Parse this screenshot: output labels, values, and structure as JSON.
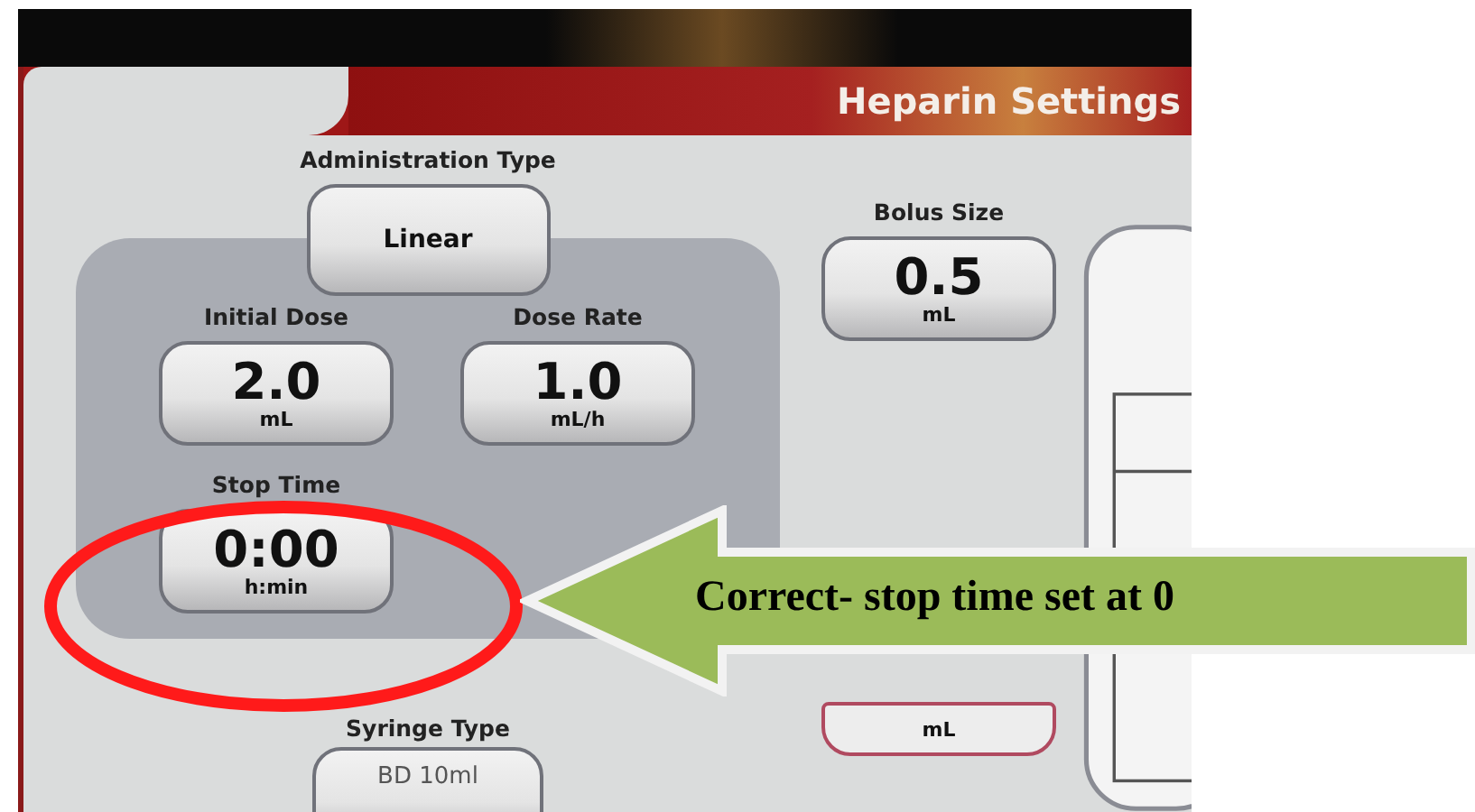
{
  "header": {
    "title": "Heparin Settings"
  },
  "administration_type": {
    "label": "Administration Type",
    "value": "Linear"
  },
  "dose_group": [
    {
      "label": "Initial Dose",
      "value": "2.0",
      "unit": "mL"
    },
    {
      "label": "Dose Rate",
      "value": "1.0",
      "unit": "mL/h"
    },
    {
      "label": "Stop Time",
      "value": "0:00",
      "unit": "h:min"
    }
  ],
  "syringe_type": {
    "label": "Syringe Type",
    "value": "BD 10ml"
  },
  "bolus_size": {
    "label": "Bolus Size",
    "value": "0.5",
    "unit": "mL"
  },
  "lower_setting": {
    "unit": "mL"
  },
  "annotation": {
    "text": "Correct- stop time set at 0"
  }
}
